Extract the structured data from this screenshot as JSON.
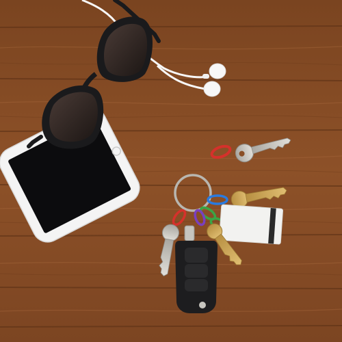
{
  "scene": {
    "description_free": true,
    "colors": {
      "wood_base": "#8a4f26",
      "wood_light": "#a4643a",
      "wood_dark": "#6b3a1a",
      "phone_body": "#f4f4f4",
      "phone_screen": "#0c0c0e",
      "sunglass_frame": "#1a1a1c",
      "lens": "#2b2422",
      "earbud": "#f7f7f7",
      "key_silver": "#c7c5bf",
      "key_gold": "#cfa95a",
      "fob_black": "#1d1d1f",
      "tag_white": "#f2f2f0",
      "tag_stripe": "#2a2a2a",
      "link_red": "#d5312b",
      "link_blue": "#2a7be0",
      "link_green": "#3aa545",
      "link_purple": "#7a3fbf",
      "link_orange": "#e07a20"
    },
    "objects": [
      "wood-tabletop",
      "sunglasses",
      "smartphone",
      "earbuds",
      "single-key-with-clip",
      "keyring-with-keys",
      "car-key-fob",
      "key-tag"
    ]
  }
}
